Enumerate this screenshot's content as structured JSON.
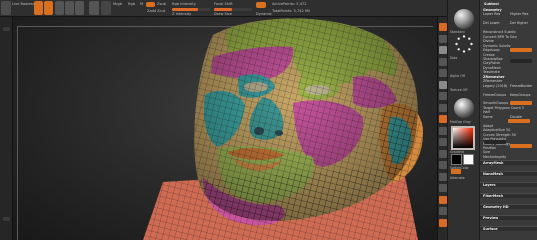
{
  "toolbar": {
    "left_label": "Live Boolean",
    "labels": [
      "Mrgb",
      "Rgb",
      "M",
      "Zadd",
      "Zsub",
      "Zcut",
      "Rgb Intensity",
      "Z Intensity",
      "Focal Shift",
      "Draw Size",
      "Dynamic",
      "ActivePoints: 5,472",
      "TotalPoints: 5,742 Mil"
    ]
  },
  "colors": {
    "accent": "#d8701f",
    "panel_bg": "#3a3a3a",
    "canvas_bg": "#2b2b2b",
    "poly_green": "#9fb84a",
    "poly_pink": "#c7549d",
    "poly_teal": "#3fa8a6",
    "poly_orange": "#d38a3d",
    "poly_tan": "#c8a768"
  },
  "right_shelf": {
    "icons": [
      "bpr-icon",
      "spix-icon",
      "scroll-icon",
      "zoom-icon",
      "actual-icon",
      "aahalf-icon",
      "persp-icon",
      "floor-icon",
      "local-icon",
      "xyz-icon",
      "frame-icon",
      "move-icon",
      "scale-icon",
      "rotate-icon",
      "polyf-icon",
      "transp-icon",
      "solo-icon",
      "xpose-icon"
    ]
  },
  "tool_column": {
    "labels": [
      "Standard",
      "Dots",
      "Alpha Off",
      "Texture Off",
      "MatCap Gray",
      "Gradient",
      "SwitchColor",
      "Alternate"
    ]
  },
  "subtool_panel": {
    "title": "Subtool",
    "rows": [
      {
        "label": "Geometry",
        "bold": true
      },
      {
        "label": "Lower Res"
      },
      {
        "label": "Higher Res"
      },
      {
        "label": "Del Lower"
      },
      {
        "label": "Del Higher"
      },
      {
        "label": "Reconstruct Subdiv"
      },
      {
        "label": "Convert BPR To Geo"
      },
      {
        "label": "Divide"
      },
      {
        "label": "Dynamic Subdiv"
      },
      {
        "label": "EdgeLoop"
      },
      {
        "label": "Crease"
      },
      {
        "label": "ShadowBox"
      },
      {
        "label": "ClayPolish"
      },
      {
        "label": "DynaMesh"
      },
      {
        "label": "Tessimate"
      },
      {
        "label": "ZRemesher",
        "bold": true
      },
      {
        "label": "ZRemesher"
      },
      {
        "label": "Legacy (2018)"
      },
      {
        "label": "FreezeBorder"
      },
      {
        "label": "FreezeGroups"
      },
      {
        "label": "KeepGroups"
      },
      {
        "label": "SmoothGroups"
      },
      {
        "label": "Target Polygons Count 5"
      },
      {
        "label": "Half"
      },
      {
        "label": "Same"
      },
      {
        "label": "Double"
      },
      {
        "label": "Adapt"
      },
      {
        "label": "AdaptiveSize 50"
      },
      {
        "label": "Curves Strength 50"
      },
      {
        "label": "Use Polypaint"
      },
      {
        "label": "Modify Topology"
      },
      {
        "label": "Position"
      },
      {
        "label": "Size"
      },
      {
        "label": "MeshIntegrity"
      }
    ],
    "sections": [
      "ArrayMesh",
      "NanoMesh",
      "Layers",
      "FiberMesh",
      "Geometry HD",
      "Preview",
      "Surface"
    ]
  }
}
